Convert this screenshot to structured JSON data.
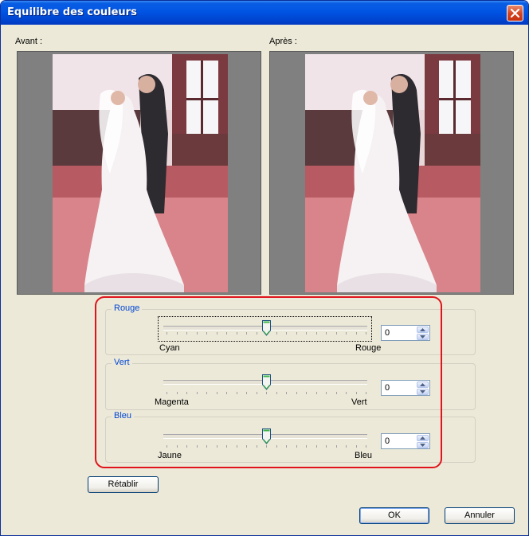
{
  "window": {
    "title": "Equilibre des couleurs"
  },
  "previews": {
    "before_label": "Avant :",
    "after_label": "Après :"
  },
  "sliders": [
    {
      "group_label": "Rouge",
      "min_label": "Cyan",
      "max_label": "Rouge",
      "value": "0"
    },
    {
      "group_label": "Vert",
      "min_label": "Magenta",
      "max_label": "Vert",
      "value": "0"
    },
    {
      "group_label": "Bleu",
      "min_label": "Jaune",
      "max_label": "Bleu",
      "value": "0"
    }
  ],
  "buttons": {
    "reset": "Rétablir",
    "ok": "OK",
    "cancel": "Annuler"
  },
  "colors": {
    "title_bar": "#0054e3",
    "group_label": "#0046d5",
    "highlight": "#e0141c"
  }
}
